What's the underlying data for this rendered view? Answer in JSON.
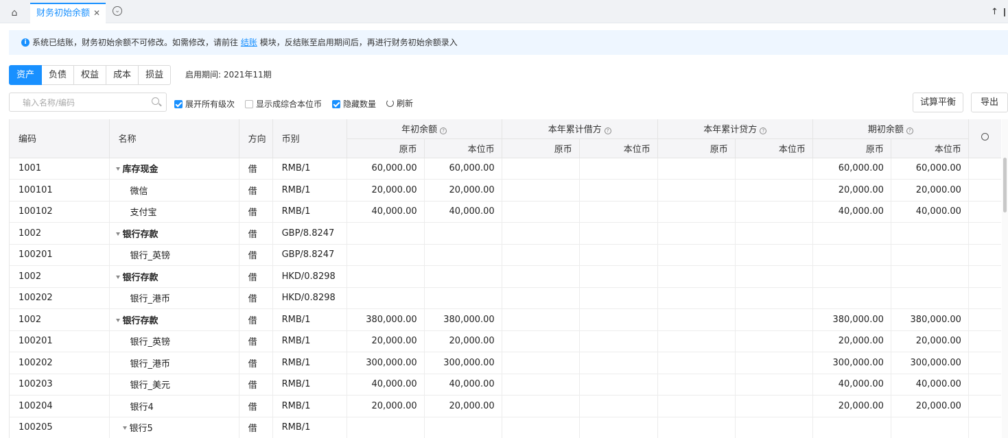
{
  "tabs": [
    {
      "label": "财务初始余额",
      "active": true
    }
  ],
  "notice": {
    "text_before": "系统已结账，财务初始余额不可修改。如需修改，请前往",
    "link": "结账",
    "text_after": "模块，反结账至启用期间后，再进行财务初始余额录入"
  },
  "categories": [
    "资产",
    "负债",
    "权益",
    "成本",
    "损益"
  ],
  "period_label": "启用期间: 2021年11期",
  "search": {
    "placeholder": "输入名称/编码"
  },
  "options": [
    {
      "label": "展开所有级次",
      "checked": true
    },
    {
      "label": "显示成综合本位币",
      "checked": false
    },
    {
      "label": "隐藏数量",
      "checked": true
    }
  ],
  "refresh_label": "刷新",
  "buttons": {
    "trial_balance": "试算平衡",
    "export": "导出"
  },
  "table": {
    "headers": {
      "code": "编码",
      "name": "名称",
      "direction": "方向",
      "currency": "币别",
      "groups": [
        "年初余额",
        "本年累计借方",
        "本年累计贷方",
        "期初余额"
      ],
      "sub": [
        "原币",
        "本位币"
      ]
    },
    "rows": [
      {
        "code": "1001",
        "name": "库存现金",
        "level": 1,
        "dir": "借",
        "cur": "RMB/1",
        "v": [
          "60,000.00",
          "60,000.00",
          "",
          "",
          "",
          "",
          "60,000.00",
          "60,000.00"
        ]
      },
      {
        "code": "100101",
        "name": "微信",
        "level": 2,
        "dir": "借",
        "cur": "RMB/1",
        "v": [
          "20,000.00",
          "20,000.00",
          "",
          "",
          "",
          "",
          "20,000.00",
          "20,000.00"
        ]
      },
      {
        "code": "100102",
        "name": "支付宝",
        "level": 2,
        "dir": "借",
        "cur": "RMB/1",
        "v": [
          "40,000.00",
          "40,000.00",
          "",
          "",
          "",
          "",
          "40,000.00",
          "40,000.00"
        ]
      },
      {
        "code": "1002",
        "name": "银行存款",
        "level": 1,
        "dir": "借",
        "cur": "GBP/8.8247",
        "v": [
          "",
          "",
          "",
          "",
          "",
          "",
          "",
          ""
        ]
      },
      {
        "code": "100201",
        "name": "银行_英镑",
        "level": 2,
        "dir": "借",
        "cur": "GBP/8.8247",
        "v": [
          "",
          "",
          "",
          "",
          "",
          "",
          "",
          ""
        ]
      },
      {
        "code": "1002",
        "name": "银行存款",
        "level": 1,
        "dir": "借",
        "cur": "HKD/0.8298",
        "v": [
          "",
          "",
          "",
          "",
          "",
          "",
          "",
          ""
        ]
      },
      {
        "code": "100202",
        "name": "银行_港币",
        "level": 2,
        "dir": "借",
        "cur": "HKD/0.8298",
        "v": [
          "",
          "",
          "",
          "",
          "",
          "",
          "",
          ""
        ]
      },
      {
        "code": "1002",
        "name": "银行存款",
        "level": 1,
        "dir": "借",
        "cur": "RMB/1",
        "v": [
          "380,000.00",
          "380,000.00",
          "",
          "",
          "",
          "",
          "380,000.00",
          "380,000.00"
        ]
      },
      {
        "code": "100201",
        "name": "银行_英镑",
        "level": 2,
        "dir": "借",
        "cur": "RMB/1",
        "v": [
          "20,000.00",
          "20,000.00",
          "",
          "",
          "",
          "",
          "20,000.00",
          "20,000.00"
        ]
      },
      {
        "code": "100202",
        "name": "银行_港币",
        "level": 2,
        "dir": "借",
        "cur": "RMB/1",
        "v": [
          "300,000.00",
          "300,000.00",
          "",
          "",
          "",
          "",
          "300,000.00",
          "300,000.00"
        ]
      },
      {
        "code": "100203",
        "name": "银行_美元",
        "level": 2,
        "dir": "借",
        "cur": "RMB/1",
        "v": [
          "40,000.00",
          "40,000.00",
          "",
          "",
          "",
          "",
          "40,000.00",
          "40,000.00"
        ]
      },
      {
        "code": "100204",
        "name": "银行4",
        "level": 2,
        "dir": "借",
        "cur": "RMB/1",
        "v": [
          "20,000.00",
          "20,000.00",
          "",
          "",
          "",
          "",
          "20,000.00",
          "20,000.00"
        ]
      },
      {
        "code": "100205",
        "name": "银行5",
        "level": 2,
        "dir": "借",
        "cur": "RMB/1",
        "v": [
          "",
          "",
          "",
          "",
          "",
          "",
          "",
          ""
        ],
        "expandable": true
      }
    ]
  },
  "colors": {
    "accent": "#1890ff",
    "header_bg": "#f5f5f7",
    "notice_bg": "#eef6ff"
  }
}
